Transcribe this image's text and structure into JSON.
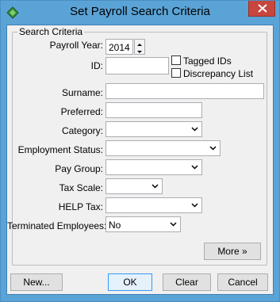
{
  "window": {
    "title": "Set Payroll Search Criteria"
  },
  "group": {
    "title": "Search Criteria"
  },
  "fields": {
    "payroll_year": {
      "label": "Payroll Year:",
      "value": "2014"
    },
    "id": {
      "label": "ID:",
      "value": ""
    },
    "tagged_ids": {
      "label": "Tagged IDs",
      "checked": false
    },
    "discrepancy_list": {
      "label": "Discrepancy List",
      "checked": false
    },
    "surname": {
      "label": "Surname:",
      "value": ""
    },
    "preferred": {
      "label": "Preferred:",
      "value": ""
    },
    "category": {
      "label": "Category:",
      "value": ""
    },
    "employment_status": {
      "label": "Employment Status:",
      "value": ""
    },
    "pay_group": {
      "label": "Pay Group:",
      "value": ""
    },
    "tax_scale": {
      "label": "Tax Scale:",
      "value": ""
    },
    "help_tax": {
      "label": "HELP Tax:",
      "value": ""
    },
    "terminated_employees": {
      "label": "Terminated Employees:",
      "value": "No"
    }
  },
  "buttons": {
    "more": "More »",
    "new": "New...",
    "ok": "OK",
    "clear": "Clear",
    "cancel": "Cancel"
  },
  "colors": {
    "titlebar": "#5aa3d6",
    "close": "#c7463d",
    "face": "#f0f0f0"
  },
  "icons": [
    "app-icon",
    "close-icon",
    "spin-up-icon",
    "spin-down-icon",
    "dropdown-arrow-icon"
  ]
}
